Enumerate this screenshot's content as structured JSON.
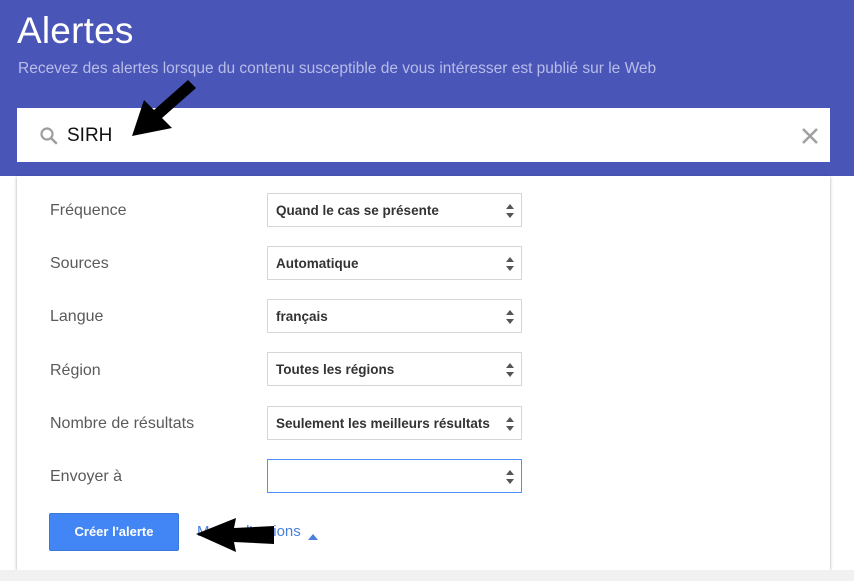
{
  "header": {
    "title": "Alertes",
    "subtitle": "Recevez des alertes lorsque du contenu susceptible de vous intéresser est publié sur le Web",
    "background_color": "#4a55b8"
  },
  "search": {
    "value": "SIRH",
    "icon": "search-icon",
    "clear_icon": "close-icon"
  },
  "options": {
    "rows": [
      {
        "label": "Fréquence",
        "value": "Quand le cas se présente"
      },
      {
        "label": "Sources",
        "value": "Automatique"
      },
      {
        "label": "Langue",
        "value": "français"
      },
      {
        "label": "Région",
        "value": "Toutes les régions"
      },
      {
        "label": "Nombre de résultats",
        "value": "Seulement les meilleurs résultats"
      },
      {
        "label": "Envoyer à",
        "value": ""
      }
    ]
  },
  "actions": {
    "create_label": "Créer l'alerte",
    "fewer_options_label": "Moins d'options",
    "accent_color": "#4285f4"
  }
}
